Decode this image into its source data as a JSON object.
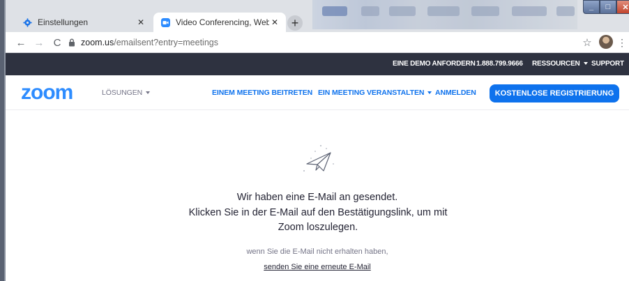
{
  "browser": {
    "tabs": [
      {
        "title": "Einstellungen",
        "icon": "gear-icon",
        "active": false
      },
      {
        "title": "Video Conferencing, Web Confer",
        "icon": "zoom-favicon",
        "active": true
      }
    ],
    "new_tab": "+",
    "url_host": "zoom.us",
    "url_path": "/emailsent?entry=meetings"
  },
  "topbar": {
    "demo": "EINE DEMO ANFORDERN",
    "phone": "1.888.799.9666",
    "resources": "RESSOURCEN",
    "support": "SUPPORT"
  },
  "nav": {
    "logo": "zoom",
    "solutions": "LÖSUNGEN",
    "join": "EINEM MEETING BEITRETEN",
    "host": "EIN MEETING VERANSTALTEN",
    "signin": "ANMELDEN",
    "signup": "KOSTENLOSE REGISTRIERUNG"
  },
  "content": {
    "line1": "Wir haben eine E-Mail an gesendet.",
    "line2": "Klicken Sie in der E-Mail auf den Bestätigungslink, um mit Zoom loszulegen.",
    "not_received": "wenn Sie die E-Mail nicht erhalten haben,",
    "resend": "senden Sie eine erneute E-Mail"
  },
  "colors": {
    "brand_blue": "#2d8cff",
    "cta_blue": "#0e72ed",
    "topbar_bg": "#2e3240"
  }
}
